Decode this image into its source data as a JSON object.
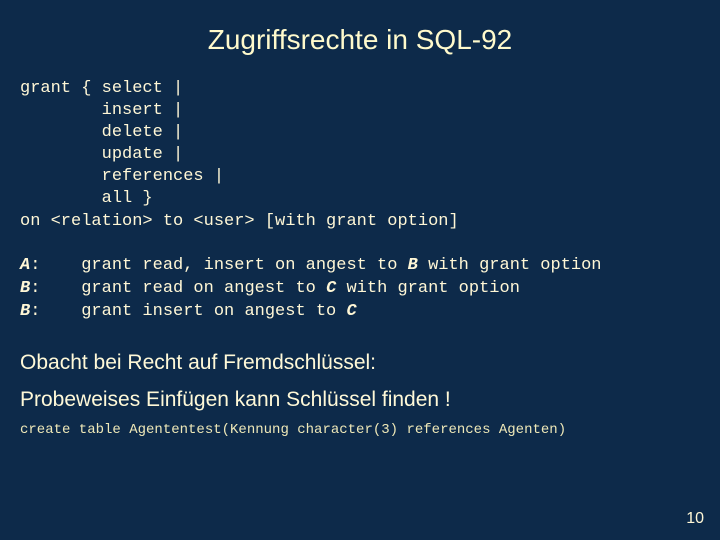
{
  "title": "Zugriffsrechte in SQL-92",
  "syntax": {
    "l1": "grant { select |",
    "l2": "        insert |",
    "l3": "        delete |",
    "l4": "        update |",
    "l5": "        references |",
    "l6": "        all }",
    "l7": "on <relation> to <user> [with grant option]"
  },
  "examples": {
    "row1": {
      "label": "A",
      "prefix": ":    grant read, insert on angest to ",
      "target": "B",
      "suffix": " with grant option"
    },
    "row2": {
      "label": "B",
      "prefix": ":    grant read on angest to ",
      "target": "C",
      "suffix": " with grant option"
    },
    "row3": {
      "label": "B",
      "prefix": ":    grant insert on angest to ",
      "target": "C",
      "suffix": ""
    }
  },
  "note": {
    "line1": "Obacht bei Recht auf Fremdschlüssel:",
    "line2": "Probeweises Einfügen kann Schlüssel finden !"
  },
  "create_stmt": "create table Agententest(Kennung character(3) references Agenten)",
  "page_number": "10"
}
